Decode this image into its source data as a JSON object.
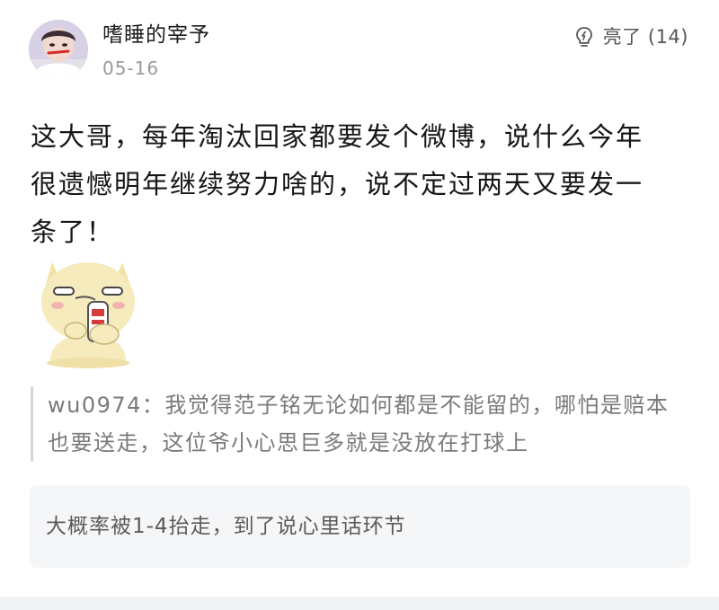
{
  "post": {
    "user": {
      "name": "嗜睡的宰予",
      "date": "05-16"
    },
    "light": {
      "label": "亮了 (14)"
    },
    "content": "这大哥，每年淘汰回家都要发个微博，说什么今年很遗憾明年继续努力啥的，说不定过两天又要发一条了！"
  },
  "quote": {
    "author": "wu0974：",
    "text": "我觉得范子铭无论如何都是不能留的，哪怕是赔本也要送走，这位爷小心思巨多就是没放在打球上"
  },
  "reply": {
    "text": "大概率被1-4抬走，到了说心里话环节"
  },
  "icons": {
    "light": "lightbulb-icon"
  },
  "colors": {
    "reply_background": "#f5f6f8",
    "quote_text": "#7a7a7a",
    "meta_text": "#9a9a9a"
  }
}
